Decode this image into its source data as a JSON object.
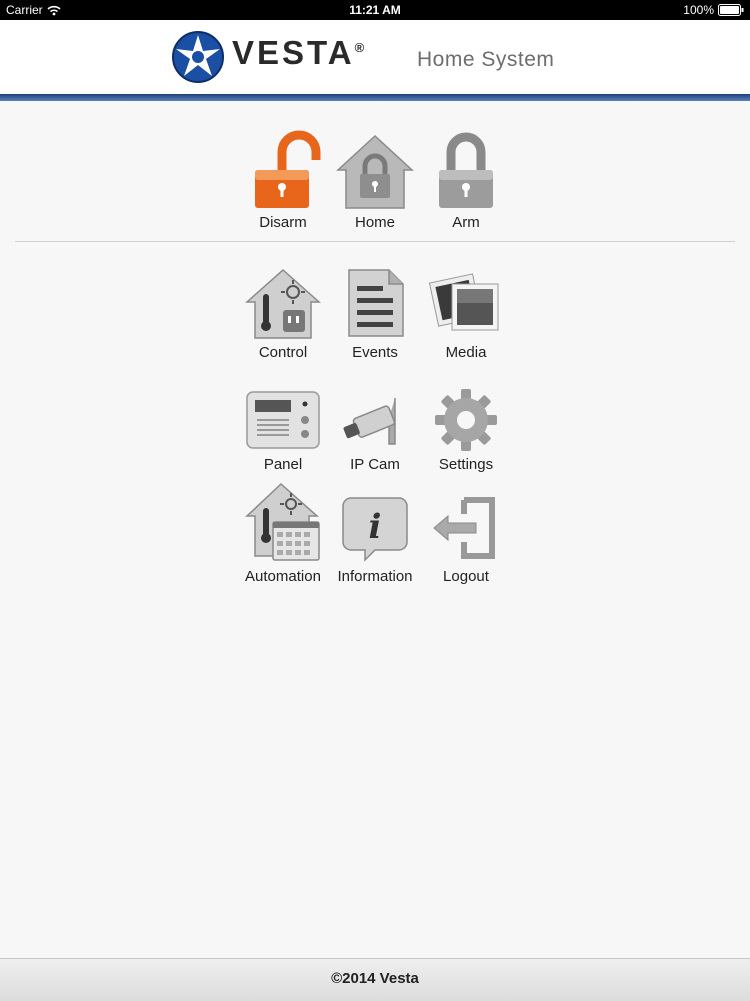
{
  "status_bar": {
    "carrier": "Carrier",
    "time": "11:21 AM",
    "battery": "100%"
  },
  "header": {
    "brand": "VESTA",
    "registered": "®",
    "subtitle": "Home System"
  },
  "security_actions": [
    {
      "label": "Disarm",
      "icon": "unlock-icon"
    },
    {
      "label": "Home",
      "icon": "home-lock-icon"
    },
    {
      "label": "Arm",
      "icon": "lock-icon"
    }
  ],
  "menu": [
    {
      "label": "Control",
      "icon": "control-house-icon"
    },
    {
      "label": "Events",
      "icon": "document-icon"
    },
    {
      "label": "Media",
      "icon": "photos-icon"
    },
    {
      "label": "Panel",
      "icon": "panel-device-icon"
    },
    {
      "label": "IP Cam",
      "icon": "camera-icon"
    },
    {
      "label": "Settings",
      "icon": "gear-icon"
    },
    {
      "label": "Automation",
      "icon": "automation-icon"
    },
    {
      "label": "Information",
      "icon": "info-icon"
    },
    {
      "label": "Logout",
      "icon": "logout-icon"
    }
  ],
  "footer": {
    "text": "©2014 Vesta"
  },
  "colors": {
    "accent": "#e8661c",
    "header_bar": "#1e3f7a",
    "icon_gray": "#9c9c9c"
  }
}
